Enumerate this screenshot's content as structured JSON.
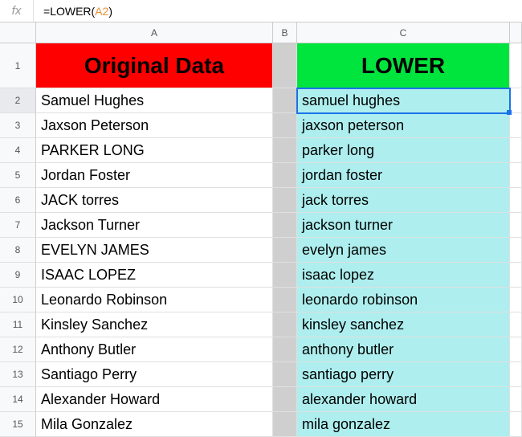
{
  "formula": {
    "eq": "=",
    "fn": "LOWER",
    "open": "(",
    "ref": "A2",
    "close": ")"
  },
  "columns": {
    "a": "A",
    "b": "B",
    "c": "C",
    "e": ""
  },
  "header": {
    "a": "Original Data",
    "c": "LOWER"
  },
  "rows": [
    {
      "n": "1"
    },
    {
      "n": "2",
      "a": "Samuel Hughes",
      "c": "samuel hughes"
    },
    {
      "n": "3",
      "a": "Jaxson Peterson",
      "c": "jaxson peterson"
    },
    {
      "n": "4",
      "a": "PARKER LONG",
      "c": "parker long"
    },
    {
      "n": "5",
      "a": "Jordan Foster",
      "c": "jordan foster"
    },
    {
      "n": "6",
      "a": "JACK torres",
      "c": "jack torres"
    },
    {
      "n": "7",
      "a": "Jackson Turner",
      "c": "jackson turner"
    },
    {
      "n": "8",
      "a": "EVELYN JAMES",
      "c": "evelyn james"
    },
    {
      "n": "9",
      "a": "ISAAC LOPEZ",
      "c": "isaac lopez"
    },
    {
      "n": "10",
      "a": "Leonardo Robinson",
      "c": "leonardo robinson"
    },
    {
      "n": "11",
      "a": "Kinsley Sanchez",
      "c": "kinsley sanchez"
    },
    {
      "n": "12",
      "a": "Anthony Butler",
      "c": "anthony butler"
    },
    {
      "n": "13",
      "a": "Santiago Perry",
      "c": "santiago perry"
    },
    {
      "n": "14",
      "a": "Alexander Howard",
      "c": "alexander howard"
    },
    {
      "n": "15",
      "a": "Mila Gonzalez",
      "c": "mila gonzalez"
    }
  ]
}
